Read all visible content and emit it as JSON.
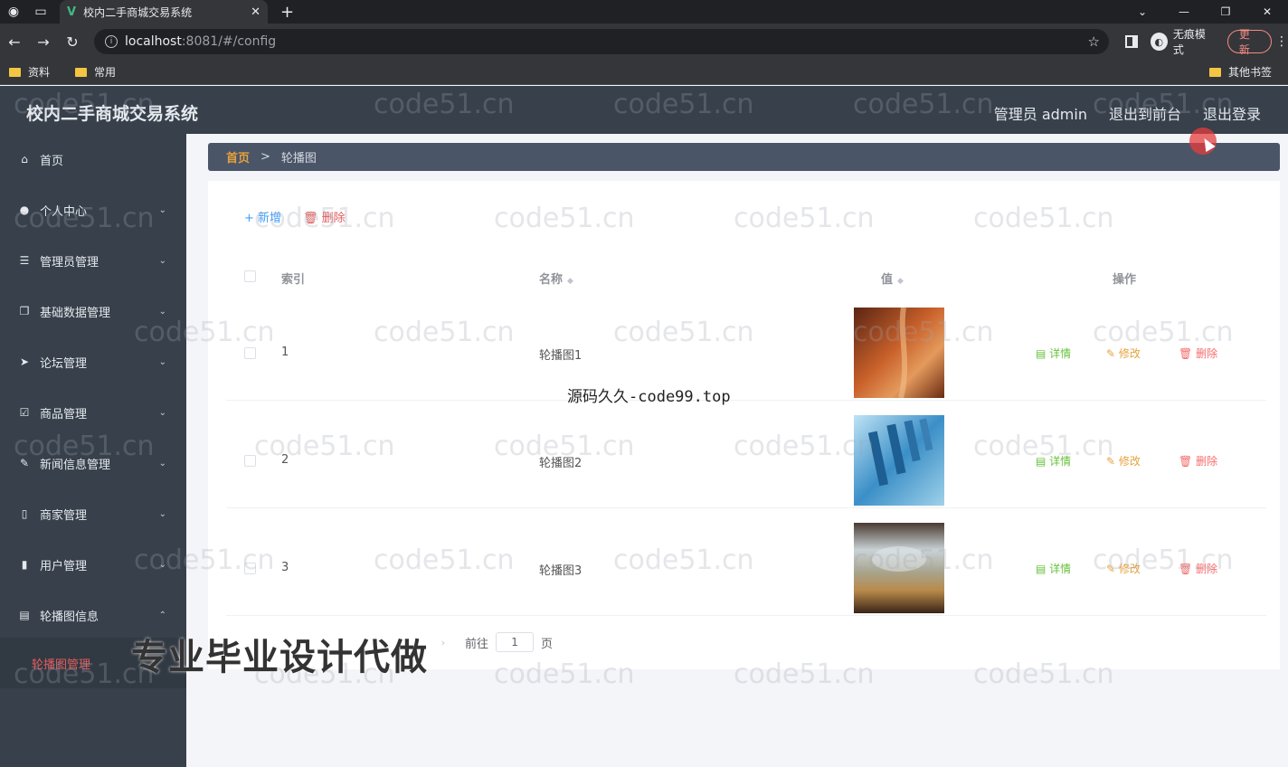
{
  "browser": {
    "tab_title": "校内二手商城交易系统",
    "url_host": "localhost",
    "url_rest": ":8081/#/config",
    "incognito_label": "无痕模式",
    "update_label": "更新",
    "bookmarks": [
      "资料",
      "常用"
    ],
    "bookmarks_other": "其他书签"
  },
  "header": {
    "title": "校内二手商城交易系统",
    "admin_label": "管理员 admin",
    "to_front_label": "退出到前台",
    "logout_label": "退出登录"
  },
  "sidebar": {
    "items": [
      {
        "label": "首页",
        "icon": "home-icon"
      },
      {
        "label": "个人中心",
        "icon": "user-icon"
      },
      {
        "label": "管理员管理",
        "icon": "list-icon"
      },
      {
        "label": "基础数据管理",
        "icon": "copy-icon"
      },
      {
        "label": "论坛管理",
        "icon": "send-icon"
      },
      {
        "label": "商品管理",
        "icon": "checkbox-icon"
      },
      {
        "label": "新闻信息管理",
        "icon": "edit-icon"
      },
      {
        "label": "商家管理",
        "icon": "phone-icon"
      },
      {
        "label": "用户管理",
        "icon": "chart-icon"
      },
      {
        "label": "轮播图信息",
        "icon": "message-icon"
      }
    ],
    "active_sub": "轮播图管理"
  },
  "breadcrumb": {
    "home": "首页",
    "sep": ">",
    "current": "轮播图"
  },
  "toolbar": {
    "add_label": "+ 新增",
    "delete_label": "删除"
  },
  "table": {
    "columns": [
      "索引",
      "名称",
      "值",
      "操作"
    ],
    "rows": [
      {
        "index": "1",
        "name": "轮播图1"
      },
      {
        "index": "2",
        "name": "轮播图2"
      },
      {
        "index": "3",
        "name": "轮播图3"
      }
    ],
    "actions": {
      "detail": "详情",
      "edit": "修改",
      "delete": "删除"
    }
  },
  "pagination": {
    "goto_label": "前往",
    "page_value": "1",
    "page_unit": "页"
  },
  "overlays": {
    "watermark": "code51.cn",
    "center_text": "源码久久-code99.top",
    "promo_text": "专业毕业设计代做"
  }
}
